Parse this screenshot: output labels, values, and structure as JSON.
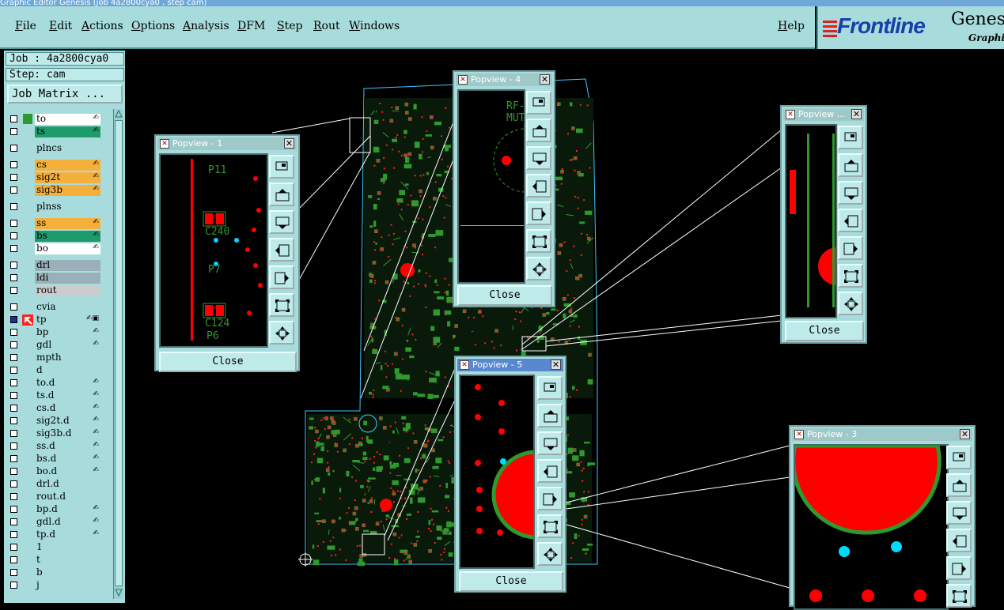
{
  "window": {
    "title": "Graphic Editor  Genesis  (job 4a2800cya0 , step cam)"
  },
  "menu": {
    "items": [
      {
        "label": "File",
        "name": "menu-file"
      },
      {
        "label": "Edit",
        "name": "menu-edit"
      },
      {
        "label": "Actions",
        "name": "menu-actions"
      },
      {
        "label": "Options",
        "name": "menu-options"
      },
      {
        "label": "Analysis",
        "name": "menu-analysis"
      },
      {
        "label": "DFM",
        "name": "menu-dfm"
      },
      {
        "label": "Step",
        "name": "menu-step"
      },
      {
        "label": "Rout",
        "name": "menu-rout"
      },
      {
        "label": "Windows",
        "name": "menu-windows"
      }
    ],
    "help": "Help"
  },
  "logo": {
    "brand": "Frontline",
    "product": "Genesis",
    "sub": "Graphic"
  },
  "job": {
    "job_line": "Job : 4a2800cya0",
    "step_line": "Step: cam",
    "matrix_button": "Job Matrix ..."
  },
  "layers": [
    {
      "name": "to",
      "bg": "#ffffff",
      "swatch": "#2e9a2e",
      "mark": "✍"
    },
    {
      "name": "ts",
      "bg": "#1f9a6a",
      "swatch": "",
      "mark": "✍"
    },
    {
      "name": "plncs",
      "bg": "#a8dcdc",
      "swatch": "",
      "mark": ""
    },
    {
      "name": "cs",
      "bg": "#f5b03c",
      "swatch": "",
      "mark": "✍"
    },
    {
      "name": "sig2t",
      "bg": "#f5b03c",
      "swatch": "",
      "mark": "✍"
    },
    {
      "name": "sig3b",
      "bg": "#f5b03c",
      "swatch": "",
      "mark": "✍"
    },
    {
      "name": "plnss",
      "bg": "#a8dcdc",
      "swatch": "",
      "mark": ""
    },
    {
      "name": "ss",
      "bg": "#f5b03c",
      "swatch": "",
      "mark": "✍"
    },
    {
      "name": "bs",
      "bg": "#1f9a6a",
      "swatch": "",
      "mark": "✍"
    },
    {
      "name": "bo",
      "bg": "#ffffff",
      "swatch": "",
      "mark": "✍"
    },
    {
      "name": "drl",
      "bg": "#9ab0b8",
      "swatch": "",
      "mark": ""
    },
    {
      "name": "ldi",
      "bg": "#9ab0b8",
      "swatch": "",
      "mark": ""
    },
    {
      "name": "rout",
      "bg": "#cccccc",
      "swatch": "",
      "mark": ""
    },
    {
      "name": "cvia",
      "bg": "#a8dcdc",
      "swatch": "",
      "mark": ""
    },
    {
      "name": "tp",
      "bg": "#a8dcdc",
      "swatch": "",
      "mark": "✍▣",
      "selected": true
    },
    {
      "name": "bp",
      "bg": "#a8dcdc",
      "swatch": "",
      "mark": "✍"
    },
    {
      "name": "gdl",
      "bg": "#a8dcdc",
      "swatch": "",
      "mark": "✍"
    },
    {
      "name": "mpth",
      "bg": "#a8dcdc",
      "swatch": "",
      "mark": ""
    },
    {
      "name": "d",
      "bg": "#a8dcdc",
      "swatch": "",
      "mark": ""
    },
    {
      "name": "to.d",
      "bg": "#a8dcdc",
      "swatch": "",
      "mark": "✍"
    },
    {
      "name": "ts.d",
      "bg": "#a8dcdc",
      "swatch": "",
      "mark": "✍"
    },
    {
      "name": "cs.d",
      "bg": "#a8dcdc",
      "swatch": "",
      "mark": "✍"
    },
    {
      "name": "sig2t.d",
      "bg": "#a8dcdc",
      "swatch": "",
      "mark": "✍"
    },
    {
      "name": "sig3b.d",
      "bg": "#a8dcdc",
      "swatch": "",
      "mark": "✍"
    },
    {
      "name": "ss.d",
      "bg": "#a8dcdc",
      "swatch": "",
      "mark": "✍"
    },
    {
      "name": "bs.d",
      "bg": "#a8dcdc",
      "swatch": "",
      "mark": "✍"
    },
    {
      "name": "bo.d",
      "bg": "#a8dcdc",
      "swatch": "",
      "mark": "✍"
    },
    {
      "name": "drl.d",
      "bg": "#a8dcdc",
      "swatch": "",
      "mark": ""
    },
    {
      "name": "rout.d",
      "bg": "#a8dcdc",
      "swatch": "",
      "mark": ""
    },
    {
      "name": "bp.d",
      "bg": "#a8dcdc",
      "swatch": "",
      "mark": "✍"
    },
    {
      "name": "gdl.d",
      "bg": "#a8dcdc",
      "swatch": "",
      "mark": "✍"
    },
    {
      "name": "tp.d",
      "bg": "#a8dcdc",
      "swatch": "",
      "mark": "✍"
    },
    {
      "name": "1",
      "bg": "#a8dcdc",
      "swatch": "",
      "mark": ""
    },
    {
      "name": "t",
      "bg": "#a8dcdc",
      "swatch": "",
      "mark": ""
    },
    {
      "name": "b",
      "bg": "#a8dcdc",
      "swatch": "",
      "mark": ""
    },
    {
      "name": "j",
      "bg": "#a8dcdc",
      "swatch": "",
      "mark": ""
    }
  ],
  "popups": [
    {
      "title": "Popview - 1",
      "close": "Close",
      "active": false,
      "labels": [
        "P11",
        "C240",
        "P7",
        "C124",
        "P6"
      ]
    },
    {
      "title": "Popview - 4",
      "close": "Close",
      "active": false,
      "labels": [
        "RF-MUT"
      ]
    },
    {
      "title": "Popview ...",
      "close": "Close",
      "active": false,
      "labels": []
    },
    {
      "title": "Popview - 5",
      "close": "Close",
      "active": true,
      "labels": []
    },
    {
      "title": "Popview - 3",
      "close": "Close",
      "active": false,
      "labels": []
    }
  ],
  "colors": {
    "panel": "#a8dcdc",
    "pad": "#ff0000",
    "trace": "#2e9a2e",
    "outline": "#40c8ff",
    "via": "#00d8ff"
  }
}
